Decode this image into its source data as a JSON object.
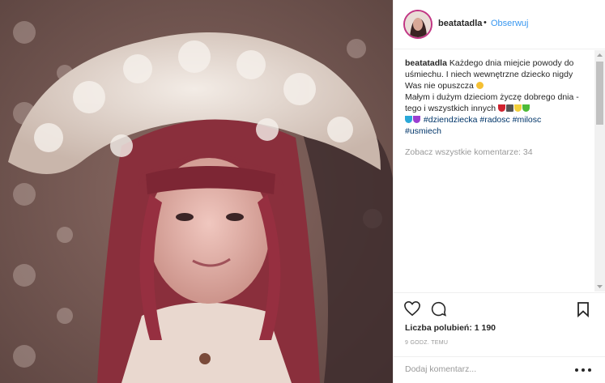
{
  "post": {
    "username": "beatatadla",
    "separator": "•",
    "follow_label": "Obserwuj",
    "caption": {
      "user": "beatatadla",
      "line1": " Każdego dnia miejcie powody do uśmiechu. I niech wewnętrzne dziecko nigdy Was nie opuszcza",
      "line2": "Małym i dużym dzieciom życzę dobrego dnia - tego i wszystkich innych",
      "hashtags": [
        "#dziendziecka",
        "#radosc",
        "#milosc",
        "#usmiech"
      ]
    },
    "view_all_comments": "Zobacz wszystkie komentarze: 34",
    "likes": "Liczba polubień: 1 190",
    "timestamp": "9 GODZ. TEMU",
    "add_comment_placeholder": "Dodaj komentarz...",
    "icons": {
      "like": "heart-outline-icon",
      "comment": "speech-bubble-icon",
      "save": "bookmark-icon",
      "more": "more-options-icon"
    },
    "colors": {
      "follow": "#3897f0",
      "hashtag": "#003569",
      "secondary_text": "#999999",
      "avatar_ring": "#c13584"
    }
  }
}
